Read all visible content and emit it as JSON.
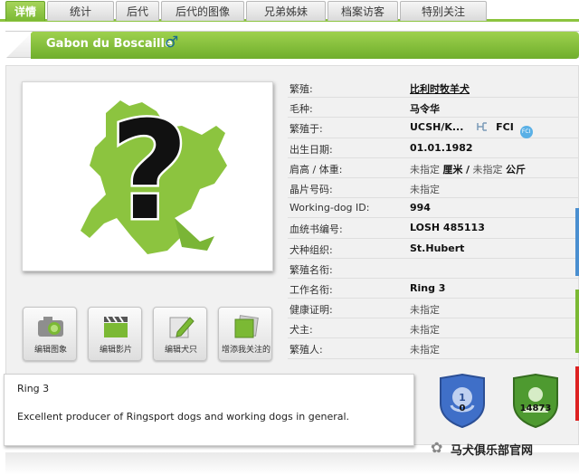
{
  "tabs": [
    "详情",
    "统计",
    "后代",
    "后代的图像",
    "兄弟姊妹",
    "档案访客",
    "特别关注"
  ],
  "header": {
    "dog_name": "Gabon du Boscaille",
    "sex_symbol": "♂"
  },
  "info": {
    "breeding_label": "繁殖:",
    "breeding_value": "比利时牧羊犬",
    "coat_label": "毛种:",
    "coat_value": "马令华",
    "bred_in_label": "繁殖于:",
    "bred_in_value": "UCSH/K...",
    "bred_in_org": "FCI",
    "fci_badge": "FCI",
    "dob_label": "出生日期:",
    "dob_value": "01.01.1982",
    "size_label": "肩高 / 体重:",
    "height_value": "未指定",
    "height_unit": "厘米",
    "sep": "/",
    "weight_value": "未指定",
    "weight_unit": "公斤",
    "chip_label": "晶片号码:",
    "chip_value": "未指定",
    "wdog_label": "Working-dog ID:",
    "wdog_value": "994",
    "pedigree_label": "血统书编号:",
    "pedigree_value": "LOSH 485113",
    "kennel_label": "犬种组织:",
    "kennel_value": "St.Hubert",
    "breed_title_label": "繁殖名衔:",
    "breed_title_value": "",
    "work_title_label": "工作名衔:",
    "work_title_value": "Ring 3",
    "health_label": "健康证明:",
    "health_value": "未指定",
    "owner_label": "犬主:",
    "owner_value": "未指定",
    "breeder_label": "繁殖人:",
    "breeder_value": "未指定"
  },
  "actions": {
    "edit_image": "编辑图象",
    "edit_video": "编辑影片",
    "edit_dog": "编辑犬只",
    "add_follow": "增添我关注的"
  },
  "description": {
    "line1": "Ring 3",
    "line2": "Excellent producer of Ringsport dogs and working dogs in general."
  },
  "badges": {
    "blue_rank": "1",
    "blue_count": "0",
    "green_count": "14873"
  },
  "watermark": "马犬俱乐部官网",
  "colors": {
    "accent_green": "#7bb934",
    "badge_blue": "#3f6fc8",
    "badge_green": "#4e9a30"
  }
}
